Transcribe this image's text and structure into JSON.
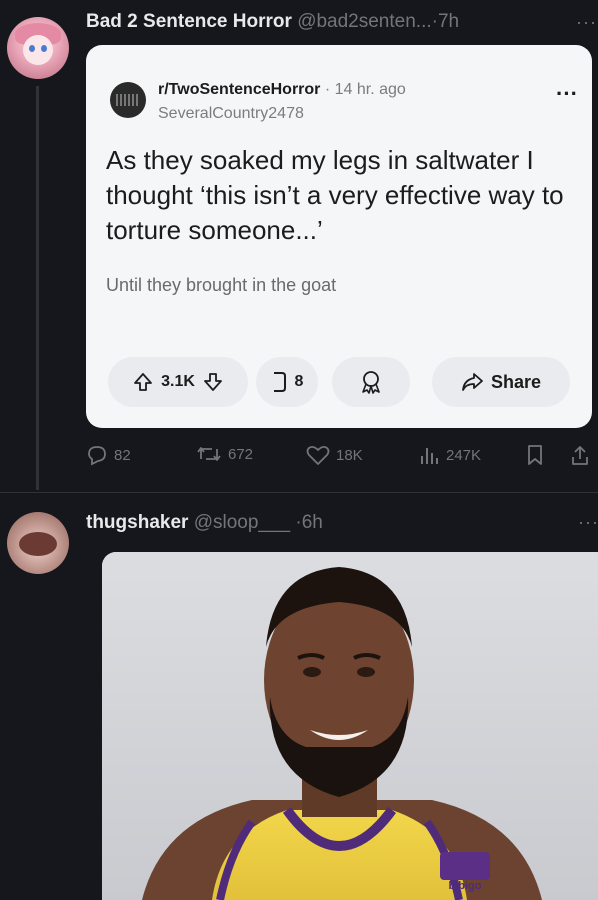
{
  "tweet1": {
    "name": "Bad 2 Sentence Horror",
    "handle": "@bad2senten...",
    "separator": "·",
    "time": "7h",
    "more": "···",
    "card": {
      "subreddit": "r/TwoSentenceHorror",
      "separator": "·",
      "post_time": "14 hr. ago",
      "author": "SeveralCountry2478",
      "more": "···",
      "title": "As they soaked my legs in saltwater I thought ‘this isn’t a very effective way to torture someone...’",
      "body": "Until they brought in the goat",
      "votes": "3.1K",
      "comments": "8",
      "share_label": "Share"
    },
    "actions": {
      "replies": "82",
      "reposts": "672",
      "likes": "18K",
      "views": "247K"
    }
  },
  "tweet2": {
    "name": "thugshaker",
    "handle": "@sloop___",
    "separator": "·",
    "time": "6h",
    "more": "···",
    "media": {
      "jersey_logo_text": "bibigo"
    }
  }
}
